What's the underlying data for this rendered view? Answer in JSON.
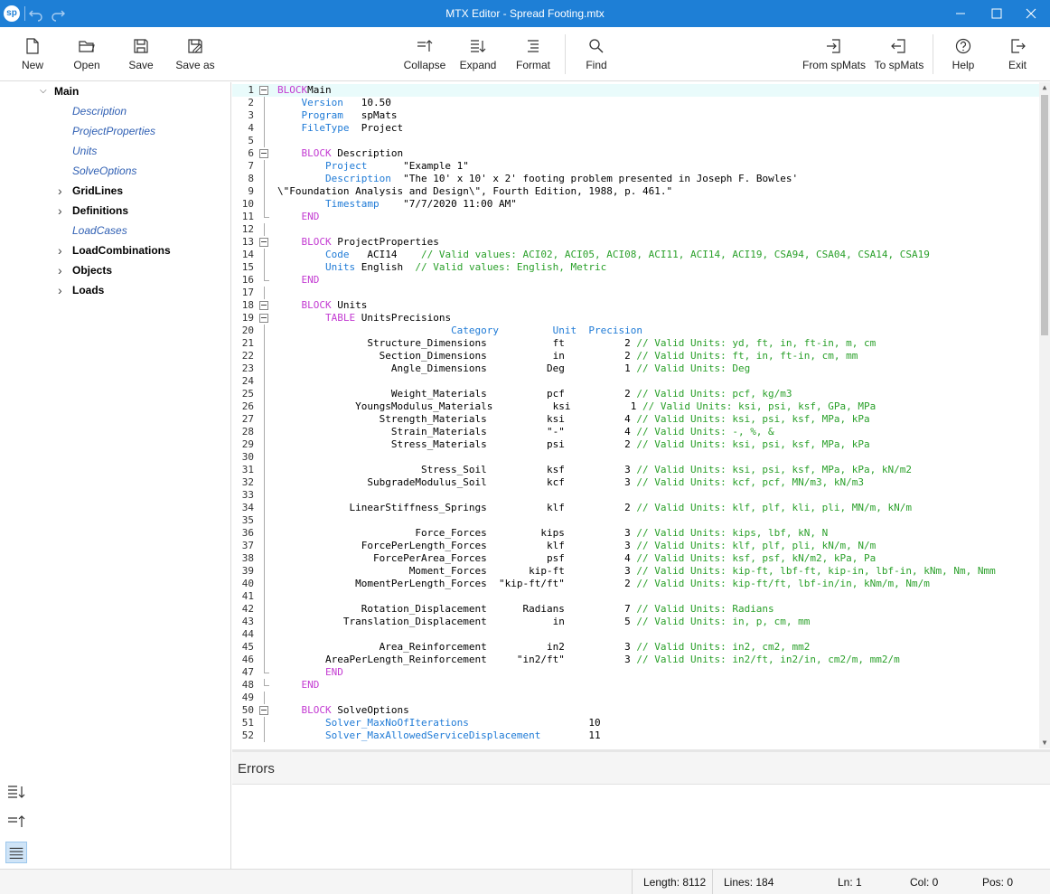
{
  "window": {
    "title": "MTX Editor - Spread Footing.mtx",
    "logo": "sp"
  },
  "toolbar": {
    "new": "New",
    "open": "Open",
    "save": "Save",
    "save_as": "Save as",
    "collapse": "Collapse",
    "expand": "Expand",
    "format": "Format",
    "find": "Find",
    "from_spmats": "From spMats",
    "to_spmats": "To spMats",
    "help": "Help",
    "exit": "Exit"
  },
  "tree": {
    "root": "Main",
    "items": [
      {
        "label": "Description",
        "kind": "leaf"
      },
      {
        "label": "ProjectProperties",
        "kind": "leaf"
      },
      {
        "label": "Units",
        "kind": "leaf"
      },
      {
        "label": "SolveOptions",
        "kind": "leaf"
      },
      {
        "label": "GridLines",
        "kind": "branch"
      },
      {
        "label": "Definitions",
        "kind": "branch"
      },
      {
        "label": "LoadCases",
        "kind": "leaf"
      },
      {
        "label": "LoadCombinations",
        "kind": "branch"
      },
      {
        "label": "Objects",
        "kind": "branch"
      },
      {
        "label": "Loads",
        "kind": "branch"
      }
    ]
  },
  "editor": {
    "lines": [
      {
        "n": "1",
        "fold": "open",
        "parts": [
          [
            "kw",
            "BLOCK"
          ],
          [
            "",
            "Main"
          ]
        ]
      },
      {
        "n": "2",
        "parts": [
          [
            "",
            "    "
          ],
          [
            "fld",
            "Version"
          ],
          [
            "",
            "   10.50"
          ]
        ]
      },
      {
        "n": "3",
        "parts": [
          [
            "",
            "    "
          ],
          [
            "fld",
            "Program"
          ],
          [
            "",
            "   spMats"
          ]
        ]
      },
      {
        "n": "4",
        "parts": [
          [
            "",
            "    "
          ],
          [
            "fld",
            "FileType"
          ],
          [
            "",
            "  Project"
          ]
        ]
      },
      {
        "n": "5",
        "parts": []
      },
      {
        "n": "6",
        "fold": "open",
        "parts": [
          [
            "",
            "    "
          ],
          [
            "kw",
            "BLOCK"
          ],
          [
            "",
            " Description"
          ]
        ]
      },
      {
        "n": "7",
        "parts": [
          [
            "",
            "        "
          ],
          [
            "fld",
            "Project"
          ],
          [
            "",
            "      \"Example 1\""
          ]
        ]
      },
      {
        "n": "8",
        "parts": [
          [
            "",
            "        "
          ],
          [
            "fld",
            "Description"
          ],
          [
            "",
            "  \"The 10' x 10' x 2' footing problem presented in Joseph F. Bowles'"
          ]
        ]
      },
      {
        "n": "9",
        "parts": [
          [
            "",
            "\\\"Foundation Analysis and Design\\\", Fourth Edition, 1988, p. 461.\""
          ]
        ]
      },
      {
        "n": "10",
        "parts": [
          [
            "",
            "        "
          ],
          [
            "fld",
            "Timestamp"
          ],
          [
            "",
            "    \"7/7/2020 11:00 AM\""
          ]
        ]
      },
      {
        "n": "11",
        "fold": "end",
        "parts": [
          [
            "",
            "    "
          ],
          [
            "kw",
            "END"
          ]
        ]
      },
      {
        "n": "12",
        "parts": []
      },
      {
        "n": "13",
        "fold": "open",
        "parts": [
          [
            "",
            "    "
          ],
          [
            "kw",
            "BLOCK"
          ],
          [
            "",
            " ProjectProperties"
          ]
        ]
      },
      {
        "n": "14",
        "parts": [
          [
            "",
            "        "
          ],
          [
            "fld",
            "Code"
          ],
          [
            "",
            "   ACI14    "
          ],
          [
            "cm",
            "// Valid values: ACI02, ACI05, ACI08, ACI11, ACI14, ACI19, CSA94, CSA04, CSA14, CSA19"
          ]
        ]
      },
      {
        "n": "15",
        "parts": [
          [
            "",
            "        "
          ],
          [
            "fld",
            "Units"
          ],
          [
            "",
            " English  "
          ],
          [
            "cm",
            "// Valid values: English, Metric"
          ]
        ]
      },
      {
        "n": "16",
        "fold": "end",
        "parts": [
          [
            "",
            "    "
          ],
          [
            "kw",
            "END"
          ]
        ]
      },
      {
        "n": "17",
        "parts": []
      },
      {
        "n": "18",
        "fold": "open",
        "parts": [
          [
            "",
            "    "
          ],
          [
            "kw",
            "BLOCK"
          ],
          [
            "",
            " Units"
          ]
        ]
      },
      {
        "n": "19",
        "fold": "open",
        "parts": [
          [
            "",
            "        "
          ],
          [
            "kw",
            "TABLE"
          ],
          [
            "",
            " UnitsPrecisions"
          ]
        ]
      },
      {
        "n": "20",
        "parts": [
          [
            "",
            "                             "
          ],
          [
            "fld",
            "Category"
          ],
          [
            "",
            "         "
          ],
          [
            "fld",
            "Unit"
          ],
          [
            "",
            "  "
          ],
          [
            "fld",
            "Precision"
          ]
        ]
      },
      {
        "n": "21",
        "parts": [
          [
            "",
            "               Structure_Dimensions           ft          2 "
          ],
          [
            "cm",
            "// Valid Units: yd, ft, in, ft-in, m, cm"
          ]
        ]
      },
      {
        "n": "22",
        "parts": [
          [
            "",
            "                 Section_Dimensions           in          2 "
          ],
          [
            "cm",
            "// Valid Units: ft, in, ft-in, cm, mm"
          ]
        ]
      },
      {
        "n": "23",
        "parts": [
          [
            "",
            "                   Angle_Dimensions          Deg          1 "
          ],
          [
            "cm",
            "// Valid Units: Deg"
          ]
        ]
      },
      {
        "n": "24",
        "parts": []
      },
      {
        "n": "25",
        "parts": [
          [
            "",
            "                   Weight_Materials          pcf          2 "
          ],
          [
            "cm",
            "// Valid Units: pcf, kg/m3"
          ]
        ]
      },
      {
        "n": "26",
        "parts": [
          [
            "",
            "             YoungsModulus_Materials          ksi          1 "
          ],
          [
            "cm",
            "// Valid Units: ksi, psi, ksf, GPa, MPa"
          ]
        ]
      },
      {
        "n": "27",
        "parts": [
          [
            "",
            "                 Strength_Materials          ksi          4 "
          ],
          [
            "cm",
            "// Valid Units: ksi, psi, ksf, MPa, kPa"
          ]
        ]
      },
      {
        "n": "28",
        "parts": [
          [
            "",
            "                   Strain_Materials          \"-\"          4 "
          ],
          [
            "cm",
            "// Valid Units: -, %, &"
          ]
        ]
      },
      {
        "n": "29",
        "parts": [
          [
            "",
            "                   Stress_Materials          psi          2 "
          ],
          [
            "cm",
            "// Valid Units: ksi, psi, ksf, MPa, kPa"
          ]
        ]
      },
      {
        "n": "30",
        "parts": []
      },
      {
        "n": "31",
        "parts": [
          [
            "",
            "                        Stress_Soil          ksf          3 "
          ],
          [
            "cm",
            "// Valid Units: ksi, psi, ksf, MPa, kPa, kN/m2"
          ]
        ]
      },
      {
        "n": "32",
        "parts": [
          [
            "",
            "               SubgradeModulus_Soil          kcf          3 "
          ],
          [
            "cm",
            "// Valid Units: kcf, pcf, MN/m3, kN/m3"
          ]
        ]
      },
      {
        "n": "33",
        "parts": []
      },
      {
        "n": "34",
        "parts": [
          [
            "",
            "            LinearStiffness_Springs          klf          2 "
          ],
          [
            "cm",
            "// Valid Units: klf, plf, kli, pli, MN/m, kN/m"
          ]
        ]
      },
      {
        "n": "35",
        "parts": []
      },
      {
        "n": "36",
        "parts": [
          [
            "",
            "                       Force_Forces         kips          3 "
          ],
          [
            "cm",
            "// Valid Units: kips, lbf, kN, N"
          ]
        ]
      },
      {
        "n": "37",
        "parts": [
          [
            "",
            "              ForcePerLength_Forces          klf          3 "
          ],
          [
            "cm",
            "// Valid Units: klf, plf, pli, kN/m, N/m"
          ]
        ]
      },
      {
        "n": "38",
        "parts": [
          [
            "",
            "                ForcePerArea_Forces          psf          4 "
          ],
          [
            "cm",
            "// Valid Units: ksf, psf, kN/m2, kPa, Pa"
          ]
        ]
      },
      {
        "n": "39",
        "parts": [
          [
            "",
            "                      Moment_Forces       kip-ft          3 "
          ],
          [
            "cm",
            "// Valid Units: kip-ft, lbf-ft, kip-in, lbf-in, kNm, Nm, Nmm"
          ]
        ]
      },
      {
        "n": "40",
        "parts": [
          [
            "",
            "             MomentPerLength_Forces  \"kip-ft/ft\"          2 "
          ],
          [
            "cm",
            "// Valid Units: kip-ft/ft, lbf-in/in, kNm/m, Nm/m"
          ]
        ]
      },
      {
        "n": "41",
        "parts": []
      },
      {
        "n": "42",
        "parts": [
          [
            "",
            "              Rotation_Displacement      Radians          7 "
          ],
          [
            "cm",
            "// Valid Units: Radians"
          ]
        ]
      },
      {
        "n": "43",
        "parts": [
          [
            "",
            "           Translation_Displacement           in          5 "
          ],
          [
            "cm",
            "// Valid Units: in, p, cm, mm"
          ]
        ]
      },
      {
        "n": "44",
        "parts": []
      },
      {
        "n": "45",
        "parts": [
          [
            "",
            "                 Area_Reinforcement          in2          3 "
          ],
          [
            "cm",
            "// Valid Units: in2, cm2, mm2"
          ]
        ]
      },
      {
        "n": "46",
        "parts": [
          [
            "",
            "        AreaPerLength_Reinforcement     \"in2/ft\"          3 "
          ],
          [
            "cm",
            "// Valid Units: in2/ft, in2/in, cm2/m, mm2/m"
          ]
        ]
      },
      {
        "n": "47",
        "fold": "end",
        "parts": [
          [
            "",
            "        "
          ],
          [
            "kw",
            "END"
          ]
        ]
      },
      {
        "n": "48",
        "fold": "end",
        "parts": [
          [
            "",
            "    "
          ],
          [
            "kw",
            "END"
          ]
        ]
      },
      {
        "n": "49",
        "parts": []
      },
      {
        "n": "50",
        "fold": "open",
        "parts": [
          [
            "",
            "    "
          ],
          [
            "kw",
            "BLOCK"
          ],
          [
            "",
            " SolveOptions"
          ]
        ]
      },
      {
        "n": "51",
        "parts": [
          [
            "",
            "        "
          ],
          [
            "fld",
            "Solver_MaxNoOfIterations"
          ],
          [
            "",
            "                    10"
          ]
        ]
      },
      {
        "n": "52",
        "parts": [
          [
            "",
            "        "
          ],
          [
            "fld",
            "Solver_MaxAllowedServiceDisplacement"
          ],
          [
            "",
            "        11"
          ]
        ]
      }
    ]
  },
  "errors": {
    "title": "Errors"
  },
  "status": {
    "length": "Length: 8112",
    "lines": "Lines: 184",
    "ln": "Ln: 1",
    "col": "Col: 0",
    "pos": "Pos: 0"
  },
  "colors": {
    "titlebar": "#1e7fd6",
    "keyword": "#c33bd2",
    "field": "#1e7ad6",
    "comment": "#2aa02a",
    "tree_leaf": "#2f5fb3"
  }
}
